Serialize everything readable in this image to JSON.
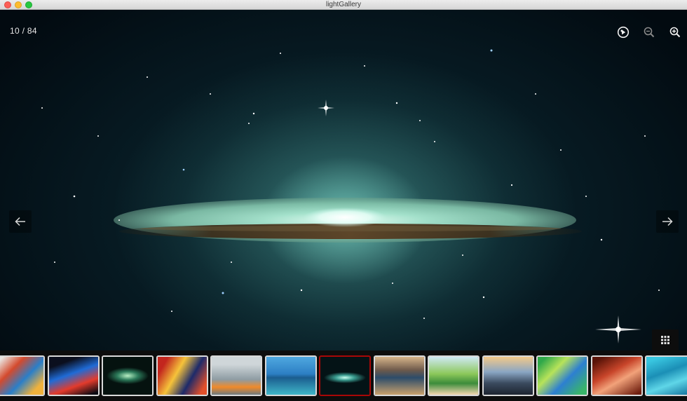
{
  "window": {
    "title": "lightGallery"
  },
  "gallery": {
    "counter": "10 / 84",
    "current_index": 10,
    "total": 84
  },
  "toolbar": {
    "buttons": [
      {
        "name": "autoplay-button",
        "icon": "play-circle-icon"
      },
      {
        "name": "zoom-out-button",
        "icon": "zoom-out-icon"
      },
      {
        "name": "zoom-in-button",
        "icon": "zoom-in-icon"
      }
    ]
  },
  "navigation": {
    "prev_icon": "arrow-left-icon",
    "next_icon": "arrow-right-icon"
  },
  "thumbnail_toggle": {
    "icon": "grid-icon"
  },
  "colors": {
    "active_thumb_border": "#a90707",
    "thumb_border": "#d9d9d9",
    "strip_bg": "#0d0d0d"
  },
  "thumbnails": [
    {
      "subject": "colorful paint smoke",
      "fill": "linear-gradient(135deg,#e9e4e0 10%,#d44a2d 35%,#2a7fc9 60%,#f0b23c 85%)"
    },
    {
      "subject": "blue and red paint burst",
      "fill": "linear-gradient(160deg,#0b0f1e 20%,#1f6bd6 45%,#e33b2c 70%,#0a0a12 95%)"
    },
    {
      "subject": "green spiral galaxy",
      "fill": "radial-gradient(ellipse 30px 12px at 50% 50%,#b8f0c4,#2c7a5a 50%,#05120f 100%)"
    },
    {
      "subject": "red and yellow paint swirl",
      "fill": "linear-gradient(120deg,#c3261e 15%,#f6c33a 40%,#1d2a6a 65%,#e2502b 90%)"
    },
    {
      "subject": "paper boats on water",
      "fill": "linear-gradient(180deg,#cfd6d9 20%,#8e9ca3 60%,#f08a2a 80%,#6d7a80 100%)"
    },
    {
      "subject": "island castle and sea",
      "fill": "linear-gradient(180deg,#4fa8e0 0%,#2d7fc4 45%,#1b5d8f 55%,#3fb6c9 100%)"
    },
    {
      "subject": "galaxy (current)",
      "fill": "radial-gradient(ellipse 30px 8px at 50% 55%,#c9fff0,#3a9c90 45%,#041316 100%)"
    },
    {
      "subject": "mountain lake reflection",
      "fill": "linear-gradient(180deg,#d7b58a 0%,#6e5a4b 35%,#2c4c6a 55%,#c9a16c 100%)"
    },
    {
      "subject": "painted cottage and tree",
      "fill": "linear-gradient(180deg,#cfe9f4 0%,#8cc85a 45%,#3c8c3a 70%,#f2d6b0 100%)"
    },
    {
      "subject": "city skyline at dusk",
      "fill": "linear-gradient(180deg,#f3c98a 0%,#8aa6c4 40%,#3a4a5e 70%,#1d2430 100%)"
    },
    {
      "subject": "green abstract pattern",
      "fill": "linear-gradient(135deg,#2fa84a 10%,#b7e35a 35%,#2d7fd1 60%,#39b56a 90%)"
    },
    {
      "subject": "antelope canyon",
      "fill": "linear-gradient(150deg,#5a1408 10%,#c8452a 40%,#f2a27a 60%,#6e1d0e 95%)"
    },
    {
      "subject": "turquoise water ripples",
      "fill": "linear-gradient(160deg,#39c6e0 10%,#1b8fb6 40%,#5fd6e8 65%,#1676a0 95%)"
    }
  ]
}
